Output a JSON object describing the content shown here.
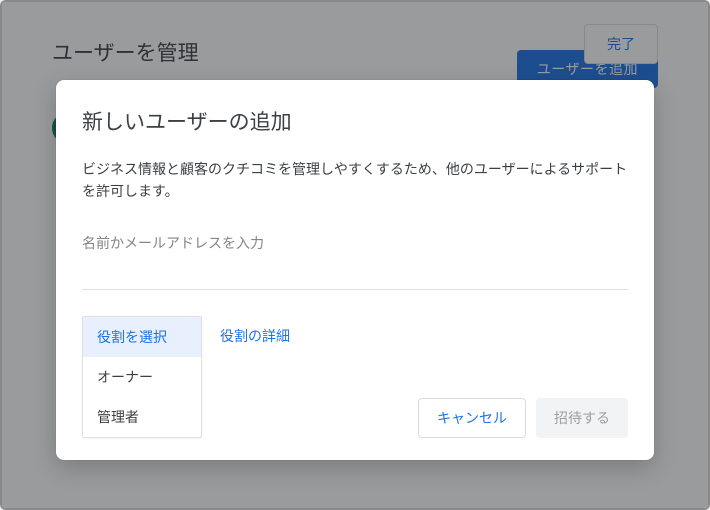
{
  "background": {
    "page_title": "ユーザーを管理",
    "add_user_button": "ユーザーを追加",
    "done_button": "完了"
  },
  "dialog": {
    "title": "新しいユーザーの追加",
    "description": "ビジネス情報と顧客のクチコミを管理しやすくするため、他のユーザーによるサポートを許可します。",
    "input_placeholder": "名前かメールアドレスを入力",
    "role_select_label": "役割を選択",
    "role_details_link": "役割の詳細",
    "role_options": {
      "owner": "オーナー",
      "manager": "管理者"
    },
    "cancel_button": "キャンセル",
    "invite_button": "招待する"
  }
}
